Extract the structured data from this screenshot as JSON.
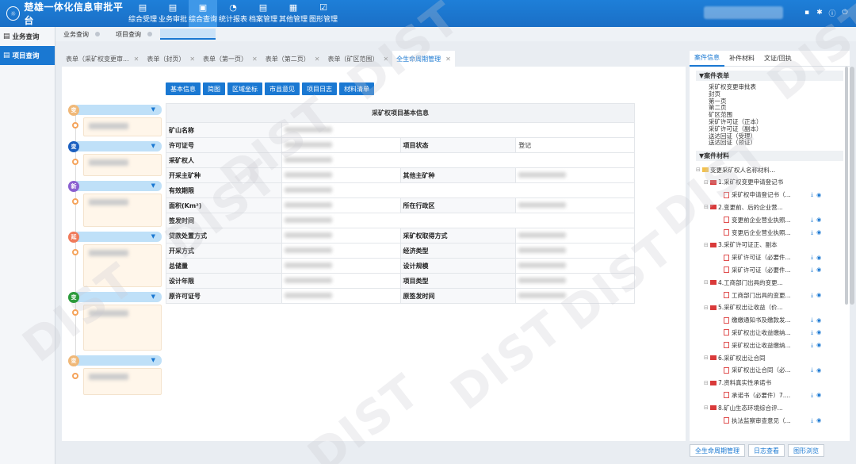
{
  "app": {
    "title": "楚雄一体化信息审批平台"
  },
  "nav": [
    {
      "label": "综合受理",
      "icon": "inbox-icon",
      "glyph": "▤"
    },
    {
      "label": "业务审批",
      "icon": "approve-icon",
      "glyph": "▤"
    },
    {
      "label": "综合查询",
      "icon": "query-icon",
      "glyph": "▣",
      "active": true
    },
    {
      "label": "统计报表",
      "icon": "pie-chart-icon",
      "glyph": "◔"
    },
    {
      "label": "档案管理",
      "icon": "archive-icon",
      "glyph": "▤"
    },
    {
      "label": "其他管理",
      "icon": "grid-icon",
      "glyph": "▦"
    },
    {
      "label": "图形管理",
      "icon": "check-square-icon",
      "glyph": "☑"
    }
  ],
  "leftnav": [
    {
      "label": "业务查询",
      "icon": "doc-search-icon",
      "active": false
    },
    {
      "label": "项目查询",
      "icon": "doc-search-icon",
      "active": true
    }
  ],
  "subtabs": [
    "业务查询",
    "项目查询"
  ],
  "doctabs": [
    {
      "label": "表单（采矿权变更审...",
      "active": false
    },
    {
      "label": "表单（封页）",
      "active": false
    },
    {
      "label": "表单（第一页）",
      "active": false
    },
    {
      "label": "表单（第二页）",
      "active": false
    },
    {
      "label": "表单（矿区范围）",
      "active": false
    },
    {
      "label": "全生命周期管理",
      "active": true
    }
  ],
  "buttons": [
    "基本信息",
    "简图",
    "区域坐标",
    "市县意见",
    "项目日志",
    "材料清单"
  ],
  "timeline": [
    {
      "badge": "变",
      "color": "#f0b878"
    },
    {
      "badge": "变",
      "color": "#1a5fc0"
    },
    {
      "badge": "新",
      "color": "#8a5fd0"
    },
    {
      "badge": "延",
      "color": "#f07a5a"
    },
    {
      "badge": "变",
      "color": "#2a9a3a"
    },
    {
      "badge": "变",
      "color": "#f0b878"
    }
  ],
  "table": {
    "title": "采矿权项目基本信息",
    "rows": [
      [
        {
          "l": "矿山名称"
        },
        {
          "v": ""
        }
      ],
      [
        {
          "l": "许可证号"
        },
        {
          "v": ""
        },
        {
          "l": "项目状态"
        },
        {
          "v": "登记"
        }
      ],
      [
        {
          "l": "采矿权人"
        },
        {
          "v": ""
        }
      ],
      [
        {
          "l": "开采主矿种"
        },
        {
          "v": ""
        },
        {
          "l": "其他主矿种"
        },
        {
          "v": ""
        }
      ],
      [
        {
          "l": "有效期限"
        },
        {
          "v": ""
        }
      ],
      [
        {
          "l": "面积(Km²)"
        },
        {
          "v": ""
        },
        {
          "l": "所在行政区"
        },
        {
          "v": ""
        }
      ],
      [
        {
          "l": "签发时间"
        },
        {
          "v": ""
        }
      ],
      [
        {
          "l": "贷款处置方式"
        },
        {
          "v": ""
        },
        {
          "l": "采矿权取得方式"
        },
        {
          "v": ""
        }
      ],
      [
        {
          "l": "开采方式"
        },
        {
          "v": ""
        },
        {
          "l": "经济类型"
        },
        {
          "v": ""
        }
      ],
      [
        {
          "l": "总储量"
        },
        {
          "v": ""
        },
        {
          "l": "设计规模"
        },
        {
          "v": ""
        }
      ],
      [
        {
          "l": "设计年限"
        },
        {
          "v": ""
        },
        {
          "l": "项目类型"
        },
        {
          "v": ""
        }
      ],
      [
        {
          "l": "原许可证号"
        },
        {
          "v": ""
        },
        {
          "l": "原签发时间"
        },
        {
          "v": ""
        }
      ]
    ]
  },
  "rpanel": {
    "tabs": [
      "案件信息",
      "补件材料",
      "文证/回执"
    ],
    "sect1": "▼案件表单",
    "forms": [
      "采矿权变更审批表",
      "封页",
      "第一页",
      "第二页",
      "矿区范围",
      "采矿许可证（正本）",
      "采矿许可证（副本）",
      "送达回证（受理）",
      "送达回证（领证）"
    ],
    "sect2": "▼案件材料",
    "tree": [
      {
        "lvl": 0,
        "label": "变更采矿权人名称材料..."
      },
      {
        "lvl": 1,
        "label": "1.采矿权变更申请登记书"
      },
      {
        "lvl": 2,
        "label": "采矿权申请登记书（..."
      },
      {
        "lvl": 1,
        "label": "2.变更前、后的企业营..."
      },
      {
        "lvl": 2,
        "label": "变更前企业营业执照..."
      },
      {
        "lvl": 2,
        "label": "变更后企业营业执照..."
      },
      {
        "lvl": 1,
        "label": "3.采矿许可证正、副本"
      },
      {
        "lvl": 2,
        "label": "采矿许可证（必要件..."
      },
      {
        "lvl": 2,
        "label": "采矿许可证（必要件..."
      },
      {
        "lvl": 1,
        "label": "4.工商部门出具的变更..."
      },
      {
        "lvl": 2,
        "label": "工商部门出具的变更..."
      },
      {
        "lvl": 1,
        "label": "5.采矿权出让收益（价..."
      },
      {
        "lvl": 2,
        "label": "缴缴通知书及缴款发..."
      },
      {
        "lvl": 2,
        "label": "采矿权出让收益缴纳..."
      },
      {
        "lvl": 2,
        "label": "采矿权出让收益缴纳..."
      },
      {
        "lvl": 1,
        "label": "6.采矿权出让合同"
      },
      {
        "lvl": 2,
        "label": "采矿权出让合同（必..."
      },
      {
        "lvl": 1,
        "label": "7.资料真实性承诺书"
      },
      {
        "lvl": 2,
        "label": "承诺书（必要件）7...."
      },
      {
        "lvl": 1,
        "label": "8.矿山生态环境综合评..."
      },
      {
        "lvl": 2,
        "label": "执法监察审查意见（..."
      }
    ]
  },
  "bottom": [
    "全生命周期管理",
    "日志查看",
    "图形浏览"
  ],
  "watermark": "DIST",
  "colors": {
    "primary": "#1a78d2",
    "nav_bg": "#1e7fd8"
  }
}
